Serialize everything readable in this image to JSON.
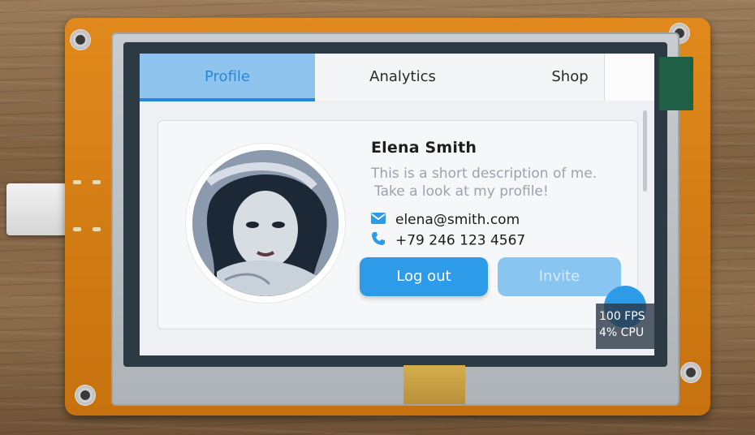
{
  "tabs": [
    {
      "label": "Profile",
      "active": true
    },
    {
      "label": "Analytics",
      "active": false
    },
    {
      "label": "Shop",
      "active": false
    }
  ],
  "profile": {
    "name": "Elena Smith",
    "description_line1": "This is a short description of me.",
    "description_line2": "Take a look at my profile!",
    "email": "elena@smith.com",
    "phone": "+79 246 123 4567",
    "avatar_icon": "profile-photo"
  },
  "buttons": {
    "logout_label": "Log out",
    "invite_label": "Invite"
  },
  "perf": {
    "fps": "100 FPS",
    "cpu": "4% CPU"
  },
  "icons": {
    "email": "envelope-icon",
    "phone": "phone-icon"
  },
  "colors": {
    "accent": "#2d9be8",
    "accent_light": "#88c5f0",
    "tab_active_bg": "#8fc4ee",
    "pcb": "#d97f18"
  }
}
